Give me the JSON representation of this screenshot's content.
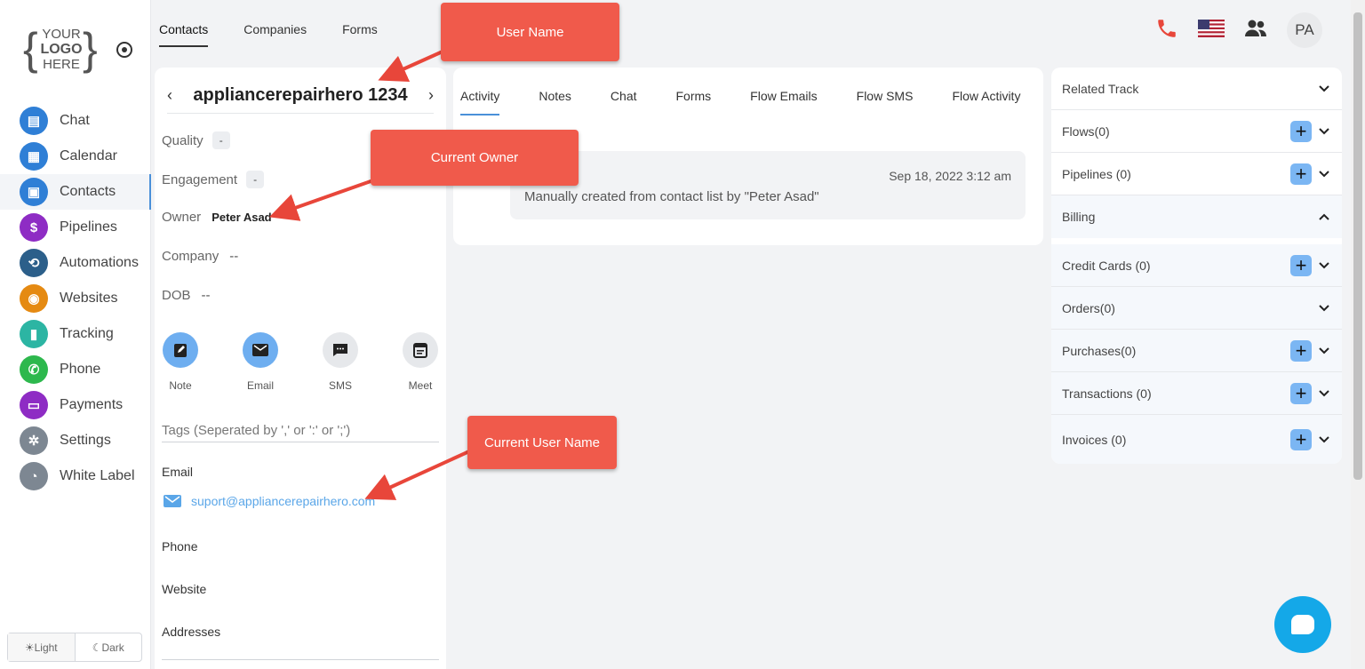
{
  "logo": {
    "line1": "YOUR",
    "line2": "LOGO",
    "line3": "HERE"
  },
  "sidebar": {
    "items": [
      {
        "label": "Chat",
        "color": "#2f7fd6",
        "icon": "chat-icon"
      },
      {
        "label": "Calendar",
        "color": "#2f7fd6",
        "icon": "calendar-icon"
      },
      {
        "label": "Contacts",
        "color": "#2f7fd6",
        "icon": "contacts-icon"
      },
      {
        "label": "Pipelines",
        "color": "#8e2cc4",
        "icon": "dollar-icon"
      },
      {
        "label": "Automations",
        "color": "#2c5f8a",
        "icon": "automation-icon"
      },
      {
        "label": "Websites",
        "color": "#e58a12",
        "icon": "globe-lock-icon"
      },
      {
        "label": "Tracking",
        "color": "#2cb5a3",
        "icon": "bar-chart-icon"
      },
      {
        "label": "Phone",
        "color": "#2db84d",
        "icon": "phone-icon"
      },
      {
        "label": "Payments",
        "color": "#8e2cc4",
        "icon": "card-icon"
      },
      {
        "label": "Settings",
        "color": "#7d8792",
        "icon": "gear-icon"
      },
      {
        "label": "White Label",
        "color": "#7d8792",
        "icon": "palette-icon"
      }
    ],
    "theme": {
      "light": "Light",
      "dark": "Dark"
    }
  },
  "top_tabs": [
    "Contacts",
    "Companies",
    "Forms"
  ],
  "header": {
    "avatar": "PA",
    "colors": {
      "phone": "#e8463a"
    }
  },
  "contact": {
    "name": "appliancerepairhero 1234",
    "quality_label": "Quality",
    "quality_value": "-",
    "engagement_label": "Engagement",
    "engagement_value": "-",
    "owner_label": "Owner",
    "owner_value": "Peter Asad",
    "company_label": "Company",
    "company_value": "--",
    "dob_label": "DOB",
    "dob_value": "--",
    "actions": [
      {
        "label": "Note",
        "icon": "note-icon"
      },
      {
        "label": "Email",
        "icon": "email-icon"
      },
      {
        "label": "SMS",
        "icon": "sms-icon"
      },
      {
        "label": "Meet",
        "icon": "meet-icon"
      }
    ],
    "tags_placeholder": "Tags (Seperated by ',' or ':' or ';')",
    "email_label": "Email",
    "email_value": "suport@appliancerepairhero.com",
    "phone_label": "Phone",
    "website_label": "Website",
    "addresses_label": "Addresses"
  },
  "activity": {
    "tabs": [
      "Activity",
      "Notes",
      "Chat",
      "Forms",
      "Flow Emails",
      "Flow SMS",
      "Flow Activity"
    ],
    "entry": {
      "date": "Sep 18, 2022 3:12 am",
      "text": "Manually created from contact list by \"Peter Asad\""
    }
  },
  "right_panel": {
    "related_track": "Related Track",
    "flows": "Flows(0)",
    "pipelines": "Pipelines (0)",
    "billing": "Billing",
    "credit_cards": "Credit Cards (0)",
    "orders": "Orders(0)",
    "purchases": "Purchases(0)",
    "transactions": "Transactions (0)",
    "invoices": "Invoices (0)",
    "plus": "+"
  },
  "callouts": {
    "user_name": "User Name",
    "current_owner": "Current Owner",
    "current_user_name": "Current User Name",
    "color": "#f05a4b"
  }
}
